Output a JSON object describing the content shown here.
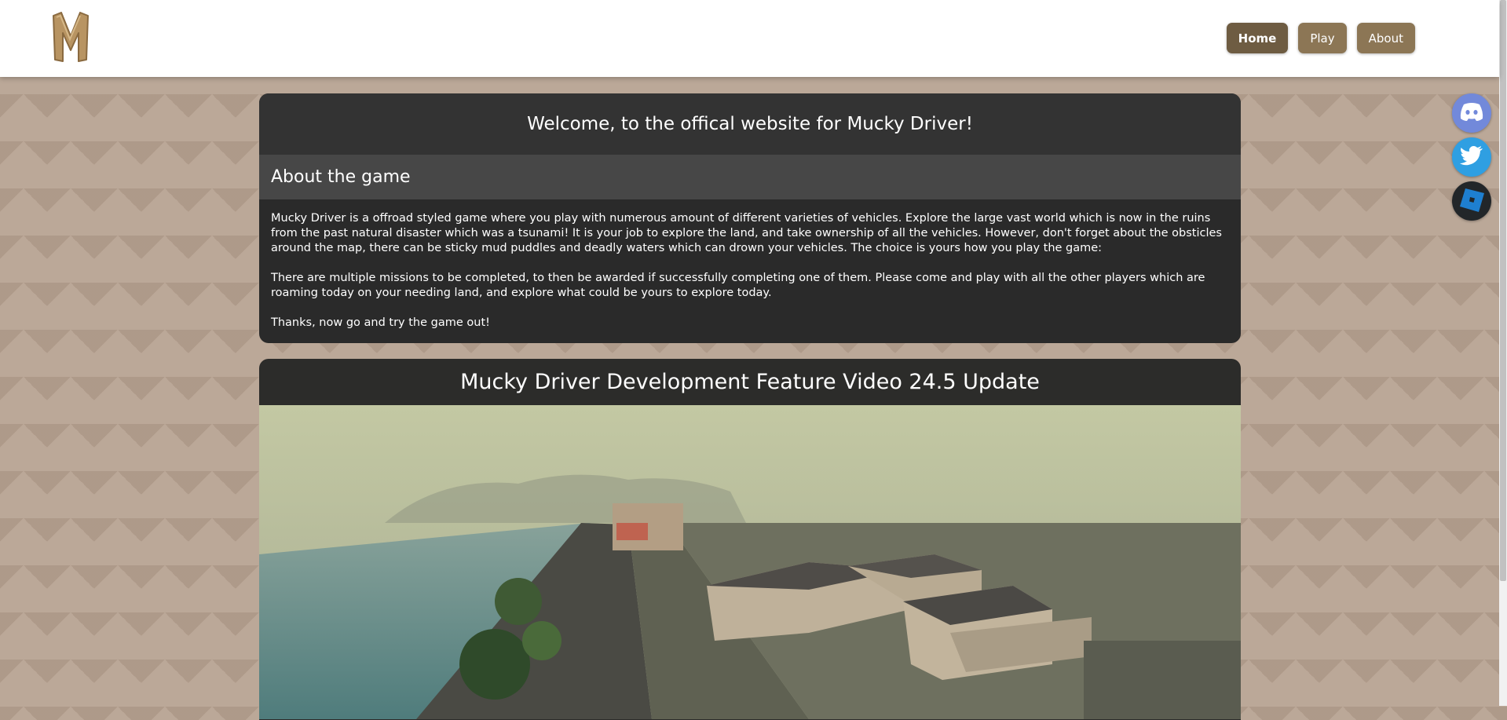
{
  "nav": {
    "items": [
      {
        "label": "Home",
        "active": true
      },
      {
        "label": "Play",
        "active": false
      },
      {
        "label": "About",
        "active": false
      }
    ]
  },
  "logo": {
    "letter": "M"
  },
  "socials": [
    "discord-icon",
    "twitter-icon",
    "roblox-icon"
  ],
  "welcome": "Welcome, to the offical website for Mucky Driver!",
  "about": {
    "heading": "About the game",
    "paragraphs": [
      "Mucky Driver is a offroad styled game where you play with numerous amount of different varieties of vehicles. Explore the large vast world which is now in the ruins from the past natural disaster which was a tsunami! It is your job to explore the land, and take ownership of all the vehicles. However, don't forget about the obsticles around the map, there can be sticky mud puddles and deadly waters which can drown your vehicles. The choice is yours how you play the game:",
      "There are multiple missions to be completed, to then be awarded if successfully completing one of them. Please come and play with all the other players which are roaming today on your needing land, and explore what could be yours to explore today.",
      "Thanks, now go and try the game out!"
    ]
  },
  "video": {
    "title": "Mucky Driver Development Feature Video 24.5 Update"
  },
  "colors": {
    "nav_button": "#8c7655",
    "nav_active": "#6e5c42",
    "card_dark": "#2a2a2a"
  }
}
